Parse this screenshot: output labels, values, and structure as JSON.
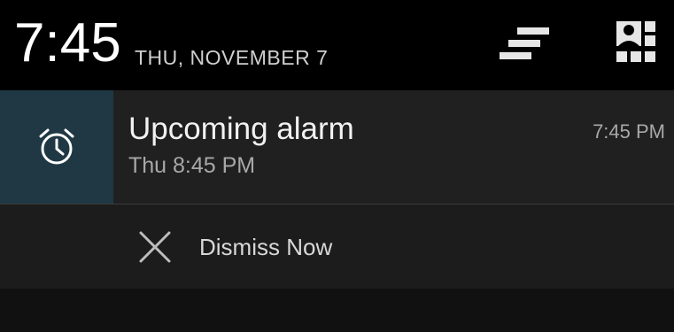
{
  "header": {
    "time": "7:45",
    "date": "THU, NOVEMBER 7",
    "clear_icon": "clear-all-icon",
    "settings_icon": "quick-settings-icon"
  },
  "notification": {
    "icon": "alarm-clock-icon",
    "title": "Upcoming alarm",
    "subtitle": "Thu 8:45 PM",
    "time": "7:45 PM",
    "accent_color": "#1f3844"
  },
  "actions": [
    {
      "icon": "close-icon",
      "label": "Dismiss Now"
    }
  ]
}
